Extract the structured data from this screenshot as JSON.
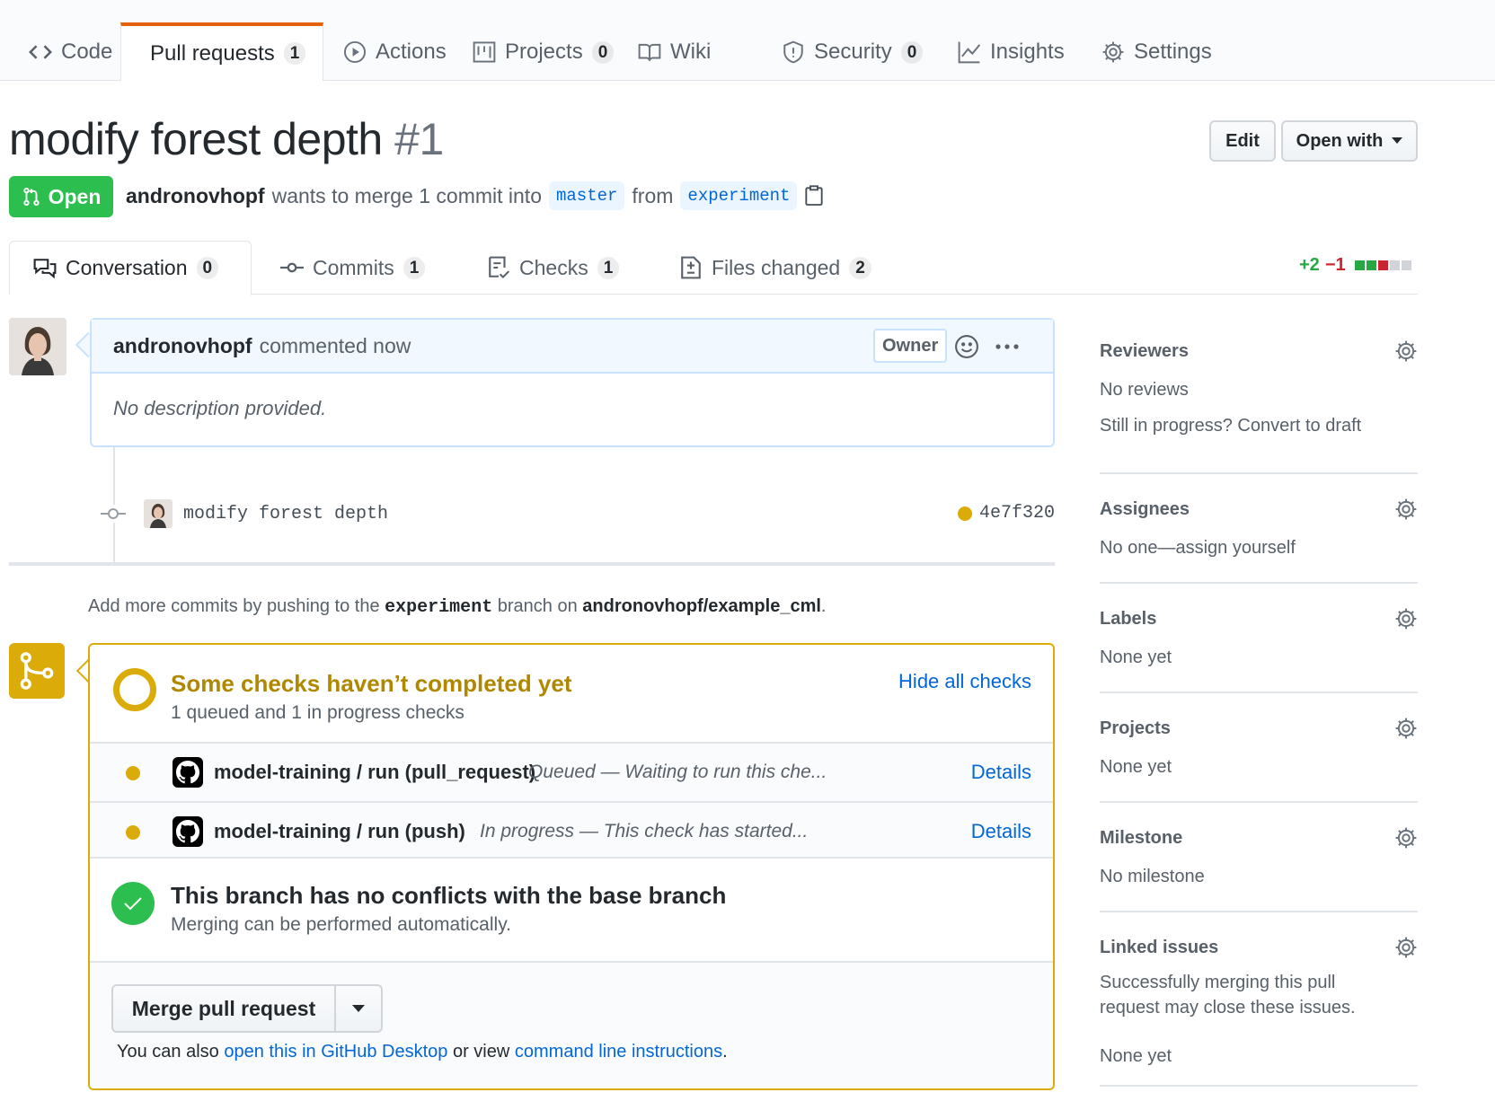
{
  "repo_nav": {
    "tabs": [
      {
        "label": "Code",
        "icon": "code-icon",
        "counter": ""
      },
      {
        "label": "Pull requests",
        "icon": "git-pull-request-icon",
        "counter": "1"
      },
      {
        "label": "Actions",
        "icon": "play-icon",
        "counter": ""
      },
      {
        "label": "Projects",
        "icon": "project-icon",
        "counter": "0"
      },
      {
        "label": "Wiki",
        "icon": "book-icon",
        "counter": ""
      },
      {
        "label": "Security",
        "icon": "shield-icon",
        "counter": "0"
      },
      {
        "label": "Insights",
        "icon": "graph-icon",
        "counter": ""
      },
      {
        "label": "Settings",
        "icon": "gear-icon",
        "counter": ""
      }
    ],
    "selected": "Pull requests"
  },
  "header": {
    "title": "modify forest depth",
    "number": "#1",
    "edit_label": "Edit",
    "open_with_label": "Open with",
    "state_label": "Open",
    "author": "andronovhopf",
    "merge_text_1": "wants to merge 1 commit into",
    "base_branch": "master",
    "merge_text_2": "from",
    "head_branch": "experiment"
  },
  "pr_tabs": [
    {
      "label": "Conversation",
      "icon": "comment-discussion-icon",
      "counter": "0"
    },
    {
      "label": "Commits",
      "icon": "git-commit-icon",
      "counter": "1"
    },
    {
      "label": "Checks",
      "icon": "checklist-icon",
      "counter": "1"
    },
    {
      "label": "Files changed",
      "icon": "file-diff-icon",
      "counter": "2"
    }
  ],
  "diffstat": {
    "additions": "+2",
    "deletions": "−1",
    "colors": [
      "#28a745",
      "#28a745",
      "#cb2431",
      "#d1d5da",
      "#d1d5da"
    ]
  },
  "comment": {
    "author": "andronovhopf",
    "action": "commented now",
    "badge": "Owner",
    "body": "No description provided."
  },
  "commit": {
    "message": "modify forest depth",
    "sha": "4e7f320"
  },
  "push_hint": {
    "text_1": "Add more commits by pushing to the",
    "branch": "experiment",
    "text_2": "branch on",
    "repo": "andronovhopf/example_cml",
    "text_3": "."
  },
  "checks": {
    "title": "Some checks haven’t completed yet",
    "subtitle": "1 queued and 1 in progress checks",
    "hide_label": "Hide all checks",
    "items": [
      {
        "name": "model-training / run (pull_request)",
        "status": "Queued — Waiting to run this che...",
        "details": "Details"
      },
      {
        "name": "model-training / run (push)",
        "status": "In progress — This check has started...",
        "details": "Details"
      }
    ]
  },
  "merge": {
    "title": "This branch has no conflicts with the base branch",
    "subtitle": "Merging can be performed automatically.",
    "button": "Merge pull request",
    "also_1": "You can also",
    "desktop_link": "open this in GitHub Desktop",
    "also_2": "or view",
    "cli_link": "command line instructions",
    "also_3": "."
  },
  "sidebar": {
    "reviewers": {
      "title": "Reviewers",
      "line1": "No reviews",
      "line2": "Still in progress? Convert to draft"
    },
    "assignees": {
      "title": "Assignees",
      "line1": "No one—assign yourself"
    },
    "labels": {
      "title": "Labels",
      "line1": "None yet"
    },
    "projects": {
      "title": "Projects",
      "line1": "None yet"
    },
    "milestone": {
      "title": "Milestone",
      "line1": "No milestone"
    },
    "linked": {
      "title": "Linked issues",
      "line1": "Successfully merging this pull request may close these issues.",
      "line2": "None yet"
    }
  },
  "colors": {
    "open_green": "#2cbe4e",
    "pending_yellow": "#dbab09",
    "link_blue": "#0366d6",
    "tab_accent": "#e36209"
  }
}
